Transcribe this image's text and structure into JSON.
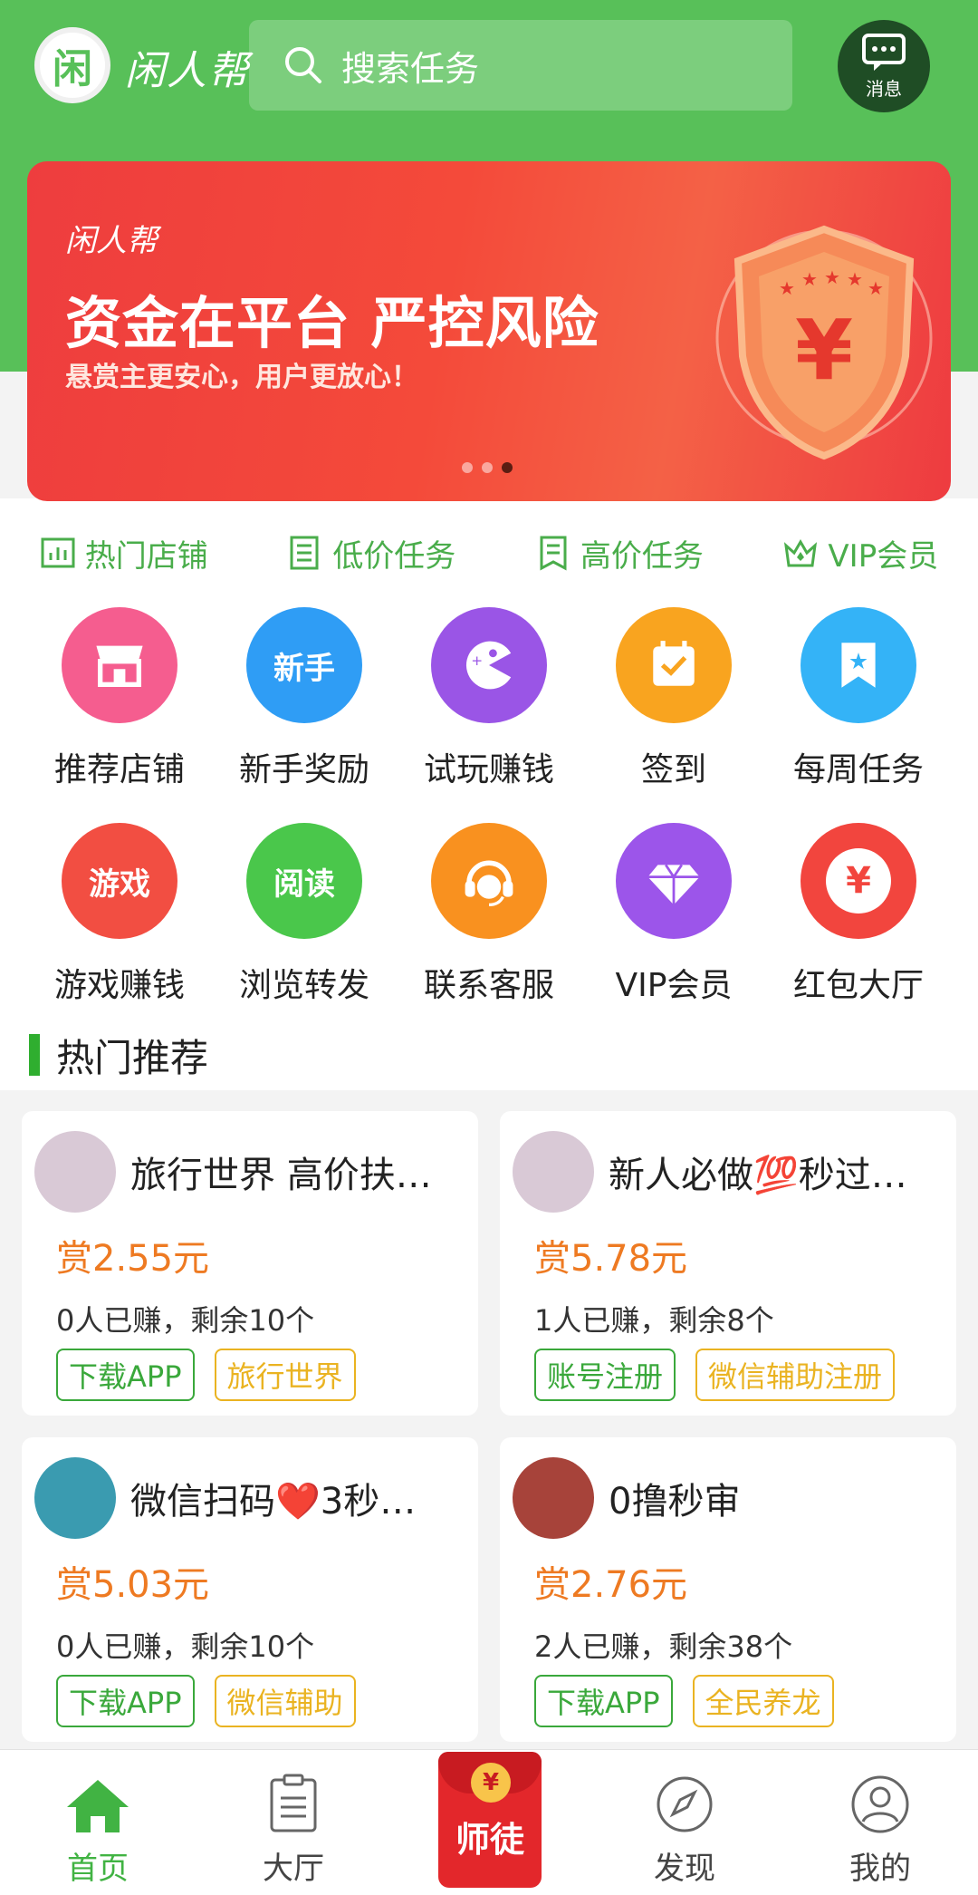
{
  "header": {
    "logo_glyph": "闲",
    "app_name": "闲人帮",
    "search_placeholder": "搜索任务",
    "message_label": "消息"
  },
  "banner": {
    "logo_text": "闲人帮",
    "title": "资金在平台 严控风险",
    "subtitle": "悬赏主更安心，用户更放心！",
    "shield_symbol": "¥",
    "slide_count": 3,
    "active_slide_index": 2
  },
  "quick_tabs": [
    {
      "label": "热门店铺",
      "icon": "bar-chart-icon"
    },
    {
      "label": "低价任务",
      "icon": "document-icon"
    },
    {
      "label": "高价任务",
      "icon": "clipboard-icon"
    },
    {
      "label": "VIP会员",
      "icon": "crown-icon"
    }
  ],
  "features": [
    {
      "label": "推荐店铺",
      "icon": "store-icon",
      "inner": "",
      "color": "#f55d8f"
    },
    {
      "label": "新手奖励",
      "icon": "newbie-icon",
      "inner": "新手",
      "color": "#2f9df5"
    },
    {
      "label": "试玩赚钱",
      "icon": "pacman-icon",
      "inner": "",
      "color": "#9a55e6"
    },
    {
      "label": "签到",
      "icon": "calendar-check-icon",
      "inner": "",
      "color": "#f9a41f"
    },
    {
      "label": "每周任务",
      "icon": "bookmark-star-icon",
      "inner": "",
      "color": "#34b3f7"
    },
    {
      "label": "游戏赚钱",
      "icon": "gamepad-icon",
      "inner": "游戏",
      "color": "#f24e42"
    },
    {
      "label": "浏览转发",
      "icon": "book-icon",
      "inner": "阅读",
      "color": "#4ac74b"
    },
    {
      "label": "联系客服",
      "icon": "headset-icon",
      "inner": "",
      "color": "#f9911f"
    },
    {
      "label": "VIP会员",
      "icon": "diamond-icon",
      "inner": "",
      "color": "#9c55ea"
    },
    {
      "label": "红包大厅",
      "icon": "red-envelope-icon",
      "inner": "¥",
      "color": "#f2453e"
    }
  ],
  "section": {
    "title": "热门推荐"
  },
  "tasks": [
    {
      "title": "旅行世界  高价扶…",
      "reward": "赏2.55元",
      "stat": "0人已赚，剩余10个",
      "tags": [
        "下载APP",
        "旅行世界"
      ],
      "avatar_color": "#d9c9d6"
    },
    {
      "title": "新人必做💯秒过…",
      "reward": "赏5.78元",
      "stat": "1人已赚，剩余8个",
      "tags": [
        "账号注册",
        "微信辅助注册"
      ],
      "avatar_color": "#d9c9d6"
    },
    {
      "title": "微信扫码❤️3秒…",
      "reward": "赏5.03元",
      "stat": "0人已赚，剩余10个",
      "tags": [
        "下载APP",
        "微信辅助"
      ],
      "avatar_color": "#3a9bb0"
    },
    {
      "title": "0撸秒审",
      "reward": "赏2.76元",
      "stat": "2人已赚，剩余38个",
      "tags": [
        "下载APP",
        "全民养龙"
      ],
      "avatar_color": "#a7433a"
    }
  ],
  "tabbar": {
    "items": [
      {
        "label": "首页",
        "icon": "home-icon",
        "active": true
      },
      {
        "label": "大厅",
        "icon": "clipboard-icon",
        "active": false
      },
      {
        "label": "师徒",
        "icon": "red-envelope-icon",
        "active": false
      },
      {
        "label": "发现",
        "icon": "compass-icon",
        "active": false
      },
      {
        "label": "我的",
        "icon": "user-icon",
        "active": false
      }
    ],
    "center_coin": "¥"
  },
  "colors": {
    "brand_green": "#58c059",
    "reward_orange": "#ee7a22",
    "tag_green": "#3aa83b",
    "tag_orange": "#eab321"
  }
}
